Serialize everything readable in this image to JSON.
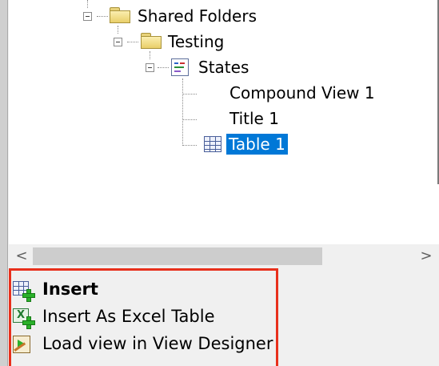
{
  "tree": {
    "nodes": [
      {
        "label": "Shared Folders"
      },
      {
        "label": "Testing"
      },
      {
        "label": "States"
      },
      {
        "label": "Compound View 1"
      },
      {
        "label": "Title 1"
      },
      {
        "label": "Table 1"
      }
    ],
    "selected_label": "Table 1"
  },
  "scrollbar": {
    "left_arrow": "<",
    "right_arrow": ">"
  },
  "actions": [
    {
      "label": "Insert",
      "icon": "insert-table-icon"
    },
    {
      "label": "Insert As Excel Table",
      "icon": "insert-excel-table-icon"
    },
    {
      "label": "Load view in View Designer",
      "icon": "view-designer-icon"
    }
  ],
  "colors": {
    "selection": "#0078d7",
    "highlight_border": "#e8301c"
  }
}
